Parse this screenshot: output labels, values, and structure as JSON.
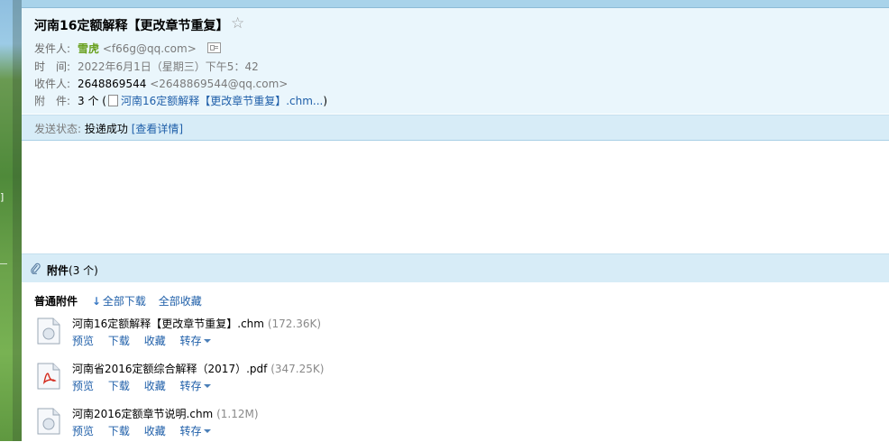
{
  "email": {
    "subject": "河南16定额解释【更改章节重复】",
    "star_icon": "star-outline-icon",
    "sender": {
      "label": "发件人:",
      "name": "雪虎",
      "address": "<f66g@qq.com>",
      "card_icon": "contact-card-icon"
    },
    "time": {
      "label": "时　间:",
      "value": "2022年6月1日（星期三）下午5：42"
    },
    "recipient": {
      "label": "收件人:",
      "name": "2648869544",
      "address": "<2648869544@qq.com>"
    },
    "attachments_summary": {
      "label": "附　件:",
      "count_text": "3 个 (",
      "first_file": "河南16定额解释【更改章节重复】.chm...",
      "close": ")"
    }
  },
  "status": {
    "label": "发送状态:",
    "value": "投递成功",
    "details_link": "[查看详情]"
  },
  "attachments": {
    "title": "附件",
    "count": "(3 个)",
    "kind_label": "普通附件",
    "download_all": "全部下载",
    "save_all": "全部收藏",
    "action_labels": {
      "preview": "预览",
      "download": "下载",
      "favorite": "收藏",
      "save_to": "转存"
    },
    "files": [
      {
        "name": "河南16定额解释【更改章节重复】.chm",
        "size": "(172.36K)",
        "icon": "chm-file-icon"
      },
      {
        "name": "河南省2016定额综合解释（2017）.pdf",
        "size": "(347.25K)",
        "icon": "pdf-file-icon"
      },
      {
        "name": "河南2016定额章节说明.chm",
        "size": "(1.12M)",
        "icon": "chm-file-icon"
      }
    ]
  },
  "colors": {
    "header_bg": "#eaf6fc",
    "bar_bg": "#d7ecf7",
    "link": "#1f5fa9",
    "sender": "#6aa121"
  }
}
